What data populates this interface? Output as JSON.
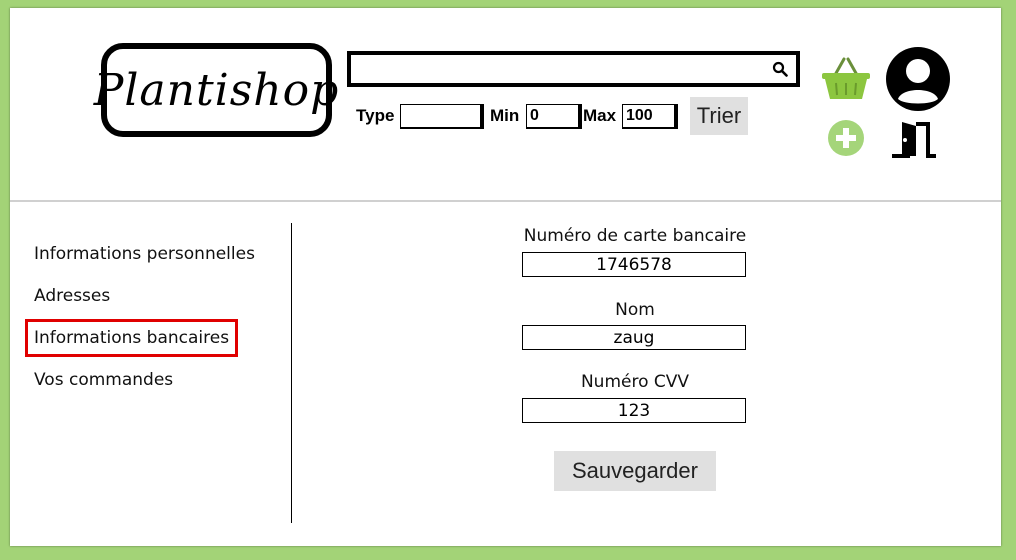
{
  "header": {
    "logo_text": "Plantishop",
    "search": {
      "value": "",
      "placeholder": ""
    },
    "filters": {
      "type_label": "Type",
      "type_value": "",
      "min_label": "Min",
      "min_value": "0",
      "max_label": "Max",
      "max_value": "100",
      "sort_label": "Trier"
    },
    "icons": [
      "basket-icon",
      "user-account-icon",
      "add-icon",
      "logout-door-icon"
    ]
  },
  "sidebar": {
    "items": [
      {
        "label": "Informations personnelles",
        "active": false
      },
      {
        "label": "Adresses",
        "active": false
      },
      {
        "label": "Informations bancaires",
        "active": true
      },
      {
        "label": "Vos commandes",
        "active": false
      }
    ]
  },
  "form": {
    "card_number_label": "Numéro de carte bancaire",
    "card_number_value": "1746578",
    "name_label": "Nom",
    "name_value": "zaug",
    "cvv_label": "Numéro CVV",
    "cvv_value": "123",
    "save_label": "Sauvegarder"
  },
  "colors": {
    "background": "#a3d377",
    "basket": "#8cc63f",
    "add": "#a5d57a",
    "active_outline": "#e00000",
    "button": "#e0e0e0"
  }
}
